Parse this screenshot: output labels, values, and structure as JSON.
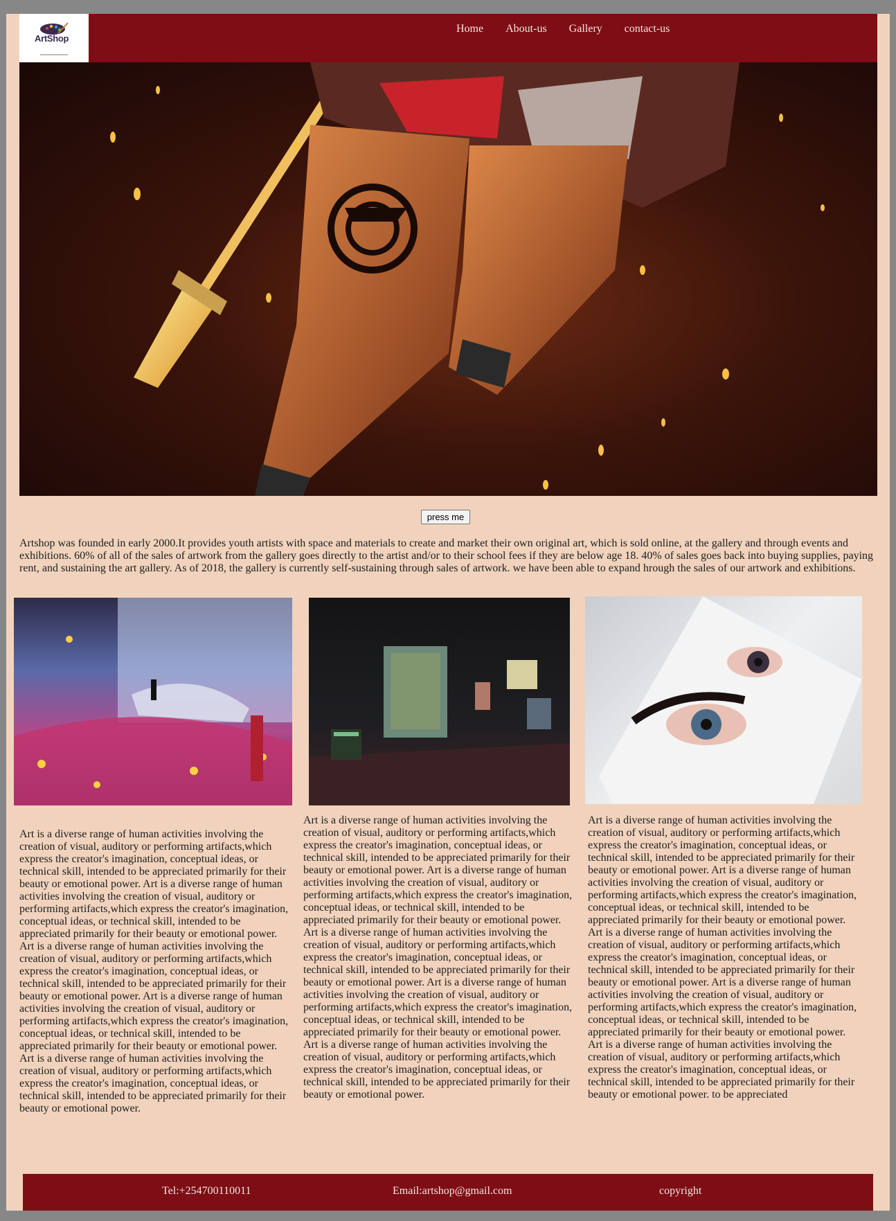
{
  "header": {
    "logo_text": "ArtShop",
    "nav": [
      "Home",
      "About-us",
      "Gallery",
      "contact-us"
    ]
  },
  "hero": {
    "icon": "hero-artwork-image"
  },
  "press_button": "press me",
  "intro": "Artshop was founded in early 2000.It provides youth artists with space and materials to create and market their own original art, which is sold online, at the gallery and through events and exhibitions. 60% of all of the sales of artwork from the gallery goes directly to the artist and/or to their school fees if they are below age 18. 40% of sales goes back into buying supplies, paying rent, and sustaining the art gallery. As of 2018, the gallery is currently self-sustaining through sales of artwork. we have been able to expand hrough the sales of our artwork and exhibitions.",
  "gallery": {
    "images": [
      "immersive-light-exhibit-image",
      "gallery-room-image",
      "eyes-painting-image"
    ],
    "columns": [
      "Art is a diverse range of human activities involving the creation of visual, auditory or performing artifacts,which express the creator's imagination, conceptual ideas, or technical skill, intended to be appreciated primarily for their beauty or emotional power. Art is a diverse range of human activities involving the creation of visual, auditory or performing artifacts,which express the creator's imagination, conceptual ideas, or technical skill, intended to be appreciated primarily for their beauty or emotional power. Art is a diverse range of human activities involving the creation of visual, auditory or performing artifacts,which express the creator's imagination, conceptual ideas, or technical skill, intended to be appreciated primarily for their beauty or emotional power. Art is a diverse range of human activities involving the creation of visual, auditory or performing artifacts,which express the creator's imagination, conceptual ideas, or technical skill, intended to be appreciated primarily for their beauty or emotional power. Art is a diverse range of human activities involving the creation of visual, auditory or performing artifacts,which express the creator's imagination, conceptual ideas, or technical skill, intended to be appreciated primarily for their beauty or emotional power.",
      "Art is a diverse range of human activities involving the creation of visual, auditory or performing artifacts,which express the creator's imagination, conceptual ideas, or technical skill, intended to be appreciated primarily for their beauty or emotional power. Art is a diverse range of human activities involving the creation of visual, auditory or performing artifacts,which express the creator's imagination, conceptual ideas, or technical skill, intended to be appreciated primarily for their beauty or emotional power. Art is a diverse range of human activities involving the creation of visual, auditory or performing artifacts,which express the creator's imagination, conceptual ideas, or technical skill, intended to be appreciated primarily for their beauty or emotional power. Art is a diverse range of human activities involving the creation of visual, auditory or performing artifacts,which express the creator's imagination, conceptual ideas, or technical skill, intended to be appreciated primarily for their beauty or emotional power. Art is a diverse range of human activities involving the creation of visual, auditory or performing artifacts,which express the creator's imagination, conceptual ideas, or technical skill, intended to be appreciated primarily for their beauty or emotional power.",
      "Art is a diverse range of human activities involving the creation of visual, auditory or performing artifacts,which express the creator's imagination, conceptual ideas, or technical skill, intended to be appreciated primarily for their beauty or emotional power. Art is a diverse range of human activities involving the creation of visual, auditory or performing artifacts,which express the creator's imagination, conceptual ideas, or technical skill, intended to be appreciated primarily for their beauty or emotional power. Art is a diverse range of human activities involving the creation of visual, auditory or performing artifacts,which express the creator's imagination, conceptual ideas, or technical skill, intended to be appreciated primarily for their beauty or emotional power. Art is a diverse range of human activities involving the creation of visual, auditory or performing artifacts,which express the creator's imagination, conceptual ideas, or technical skill, intended to be appreciated primarily for their beauty or emotional power. Art is a diverse range of human activities involving the creation of visual, auditory or performing artifacts,which express the creator's imagination, conceptual ideas, or technical skill, intended to be appreciated primarily for their beauty or emotional power. to be appreciated"
    ]
  },
  "footer": {
    "tel": "Tel:+254700110011",
    "email": "Email:artshop@gmail.com",
    "copyright": "copyright"
  },
  "colors": {
    "brand": "#7e0d16",
    "background": "#f1d3bd",
    "frame": "#878787"
  }
}
